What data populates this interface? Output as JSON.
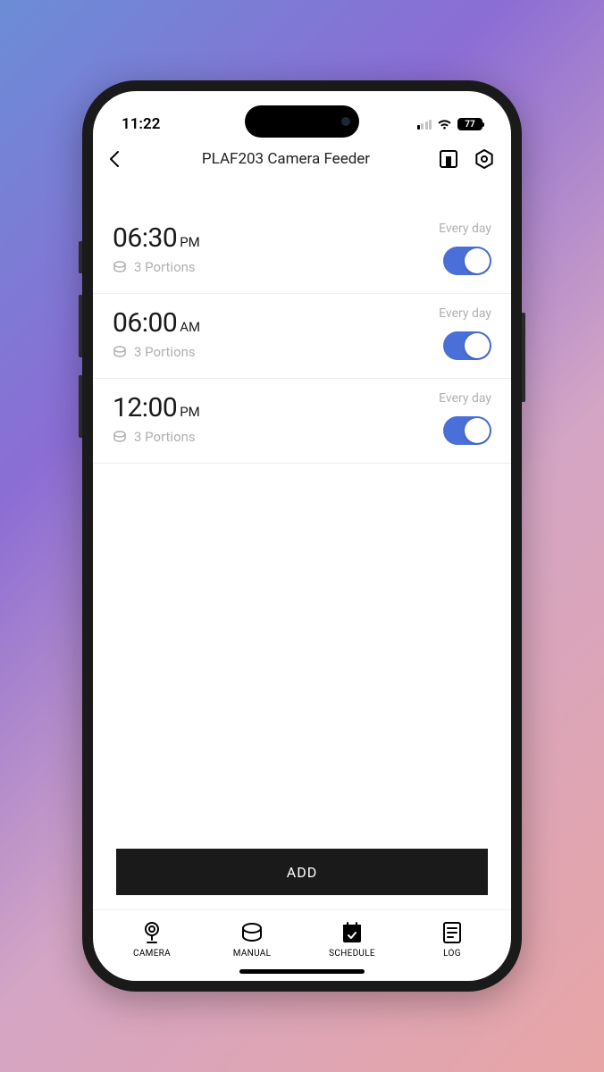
{
  "status": {
    "time": "11:22",
    "battery": "77"
  },
  "header": {
    "title": "PLAF203 Camera Feeder"
  },
  "schedule": [
    {
      "time": "06:30",
      "ampm": "PM",
      "portions": "3  Portions",
      "frequency": "Every day",
      "enabled": true
    },
    {
      "time": "06:00",
      "ampm": "AM",
      "portions": "3  Portions",
      "frequency": "Every day",
      "enabled": true
    },
    {
      "time": "12:00",
      "ampm": "PM",
      "portions": "3  Portions",
      "frequency": "Every day",
      "enabled": true
    }
  ],
  "buttons": {
    "add": "ADD"
  },
  "tabs": [
    {
      "label": "CAMERA"
    },
    {
      "label": "MANUAL"
    },
    {
      "label": "SCHEDULE"
    },
    {
      "label": "LOG"
    }
  ]
}
